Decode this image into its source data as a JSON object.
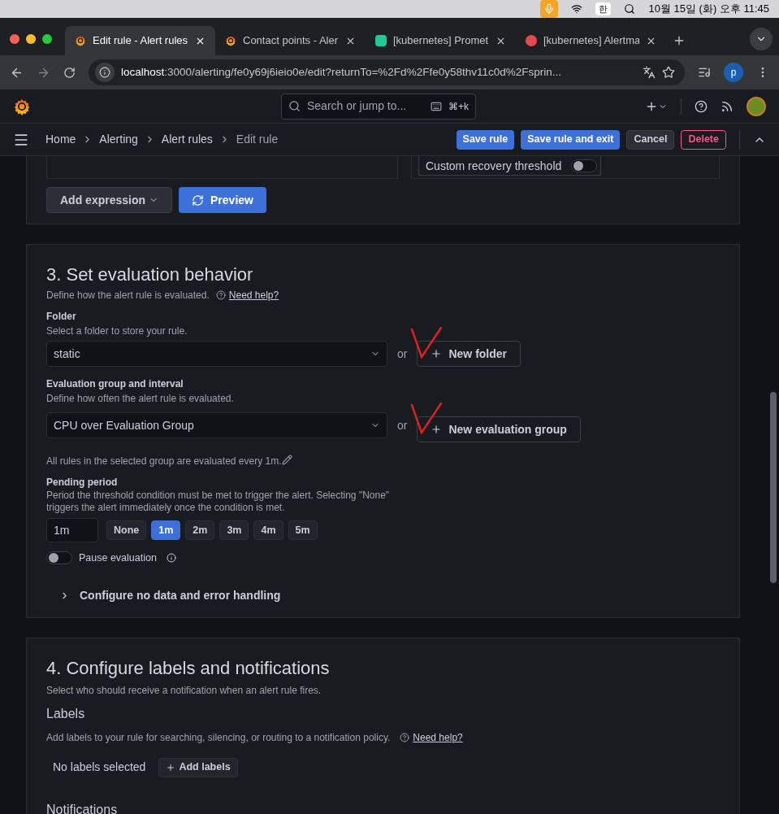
{
  "menu_bar": {
    "date_time": "10월 15일 (화) 오후 11:45",
    "ime": "한"
  },
  "tabs": [
    {
      "title": "Edit rule - Alert rules",
      "selected": true,
      "kind": "grafana"
    },
    {
      "title": "Contact points - Aler",
      "selected": false,
      "kind": "grafana"
    },
    {
      "title": "[kubernetes] Promet",
      "selected": false,
      "kind": "v"
    },
    {
      "title": "[kubernetes] Alertma",
      "selected": false,
      "kind": "alert"
    }
  ],
  "address_bar": {
    "host": "localhost",
    "rest": ":3000/alerting/fe0y69j6ieio0e/edit?returnTo=%2Fd%2Ffe0y58thv11c0d%2Fsprin...",
    "profile": "p"
  },
  "header": {
    "search_placeholder": "Search or jump to...",
    "shortcut": "⌘+k"
  },
  "breadcrumbs": [
    {
      "label": "Home",
      "selected": false
    },
    {
      "label": "Alerting",
      "selected": false
    },
    {
      "label": "Alert rules",
      "selected": false
    },
    {
      "label": "Edit rule",
      "selected": true
    }
  ],
  "actions": [
    {
      "label": "Save rule",
      "kind": "primary"
    },
    {
      "label": "Save rule and exit",
      "kind": "primary"
    },
    {
      "label": "Cancel",
      "kind": "secondary"
    },
    {
      "label": "Delete",
      "kind": "danger"
    }
  ],
  "top_panel": {
    "recovery_label": "Custom recovery threshold",
    "recovery_on": false,
    "add_expression": "Add expression",
    "preview": "Preview"
  },
  "section3": {
    "title": "3. Set evaluation behavior",
    "description": "Define how the alert rule is evaluated.",
    "help": "Need help?",
    "folder": {
      "label": "Folder",
      "description": "Select a folder to store your rule.",
      "value": "static",
      "or": "or",
      "new_button": "New folder"
    },
    "group": {
      "label": "Evaluation group and interval",
      "description": "Define how often the alert rule is evaluated.",
      "value": "CPU over Evaluation Group",
      "or": "or",
      "new_button": "New evaluation group"
    },
    "group_note": "All rules in the selected group are evaluated every 1m.",
    "pending": {
      "label": "Pending period",
      "description": "Period the threshold condition must be met to trigger the alert. Selecting \"None\" triggers the alert immediately once the condition is met.",
      "value": "1m",
      "options": [
        {
          "label": "None",
          "selected": false
        },
        {
          "label": "1m",
          "selected": true
        },
        {
          "label": "2m",
          "selected": false
        },
        {
          "label": "3m",
          "selected": false
        },
        {
          "label": "4m",
          "selected": false
        },
        {
          "label": "5m",
          "selected": false
        }
      ]
    },
    "pause": {
      "label": "Pause evaluation",
      "on": false
    },
    "no_data": {
      "label": "Configure no data and error handling",
      "expanded": false
    }
  },
  "section4": {
    "title": "4. Configure labels and notifications",
    "description": "Select who should receive a notification when an alert rule fires.",
    "labels_title": "Labels",
    "labels_description": "Add labels to your rule for searching, silencing, or routing to a notification policy.",
    "help": "Need help?",
    "no_labels": "No labels selected",
    "add_labels": "Add labels",
    "notifications_title": "Notifications"
  }
}
